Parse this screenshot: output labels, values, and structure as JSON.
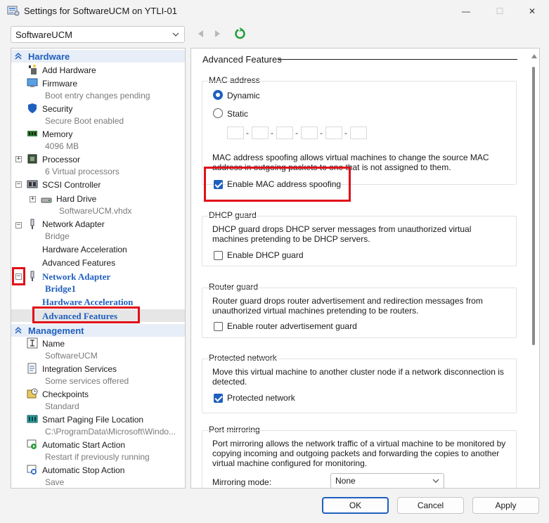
{
  "window": {
    "title": "Settings for SoftwareUCM on YTLI-01",
    "minimize": "—",
    "maximize": "☐",
    "close": "✕"
  },
  "toolbar": {
    "vm_selected": "SoftwareUCM"
  },
  "tree": {
    "hardware_header": "Hardware",
    "management_header": "Management",
    "items": {
      "add_hardware": "Add Hardware",
      "firmware": "Firmware",
      "firmware_sub": "Boot entry changes pending",
      "security": "Security",
      "security_sub": "Secure Boot enabled",
      "memory": "Memory",
      "memory_sub": "4096 MB",
      "processor": "Processor",
      "processor_sub": "6 Virtual processors",
      "scsi": "SCSI Controller",
      "hard_drive": "Hard Drive",
      "hard_drive_sub": "SoftwareUCM.vhdx",
      "net1": "Network Adapter",
      "net1_sub": "Bridge",
      "net1_hwaccel": "Hardware Acceleration",
      "net1_adv": "Advanced Features",
      "net2": "Network Adapter",
      "net2_sub": "Bridge1",
      "net2_hwaccel": "Hardware Acceleration",
      "net2_adv": "Advanced Features",
      "name": "Name",
      "name_sub": "SoftwareUCM",
      "integration": "Integration Services",
      "integration_sub": "Some services offered",
      "checkpoints": "Checkpoints",
      "checkpoints_sub": "Standard",
      "paging": "Smart Paging File Location",
      "paging_sub": "C:\\ProgramData\\Microsoft\\Windo...",
      "autostart": "Automatic Start Action",
      "autostart_sub": "Restart if previously running",
      "autostop": "Automatic Stop Action",
      "autostop_sub": "Save"
    }
  },
  "panel": {
    "title": "Advanced Features",
    "mac": {
      "title": "MAC address",
      "dynamic": "Dynamic",
      "static": "Static",
      "dynamic_selected": true,
      "desc": "MAC address spoofing allows virtual machines to change the source MAC address in outgoing packets to one that is not assigned to them.",
      "spoof_label": "Enable MAC address spoofing",
      "spoof_checked": true
    },
    "dhcp": {
      "title": "DHCP guard",
      "desc": "DHCP guard drops DHCP server messages from unauthorized virtual machines pretending to be DHCP servers.",
      "label": "Enable DHCP guard",
      "checked": false
    },
    "router": {
      "title": "Router guard",
      "desc": "Router guard drops router advertisement and redirection messages from unauthorized virtual machines pretending to be routers.",
      "label": "Enable router advertisement guard",
      "checked": false
    },
    "protected": {
      "title": "Protected network",
      "desc": "Move this virtual machine to another cluster node if a network disconnection is detected.",
      "label": "Protected network",
      "checked": true
    },
    "mirror": {
      "title": "Port mirroring",
      "desc": "Port mirroring allows the network traffic of a virtual machine to be monitored by copying incoming and outgoing packets and forwarding the copies to another virtual machine configured for monitoring.",
      "mode_label": "Mirroring mode:",
      "mode_value": "None"
    }
  },
  "buttons": {
    "ok": "OK",
    "cancel": "Cancel",
    "apply": "Apply"
  },
  "colors": {
    "accent": "#1f5fbf",
    "highlight": "#e0101a"
  }
}
